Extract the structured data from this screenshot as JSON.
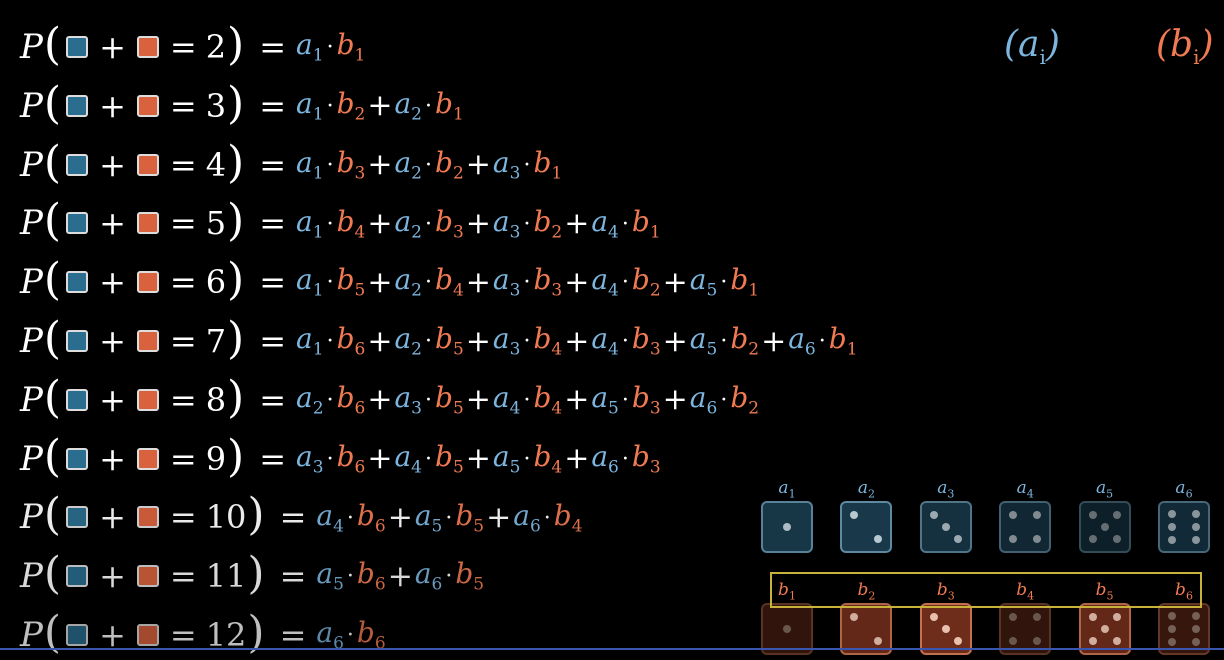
{
  "header": {
    "a_label": {
      "sym": "a",
      "sub": "i"
    },
    "b_label": {
      "sym": "b",
      "sub": "i"
    },
    "colors": {
      "a": "#7cb5de",
      "b": "#f07a52",
      "blue_die": "#2a6d8e",
      "red_die": "#d9623e",
      "highlight": "#c9b23a"
    }
  },
  "equations": [
    {
      "sum": "2",
      "terms": [
        [
          1,
          1
        ]
      ]
    },
    {
      "sum": "3",
      "terms": [
        [
          1,
          2
        ],
        [
          2,
          1
        ]
      ]
    },
    {
      "sum": "4",
      "terms": [
        [
          1,
          3
        ],
        [
          2,
          2
        ],
        [
          3,
          1
        ]
      ]
    },
    {
      "sum": "5",
      "terms": [
        [
          1,
          4
        ],
        [
          2,
          3
        ],
        [
          3,
          2
        ],
        [
          4,
          1
        ]
      ]
    },
    {
      "sum": "6",
      "terms": [
        [
          1,
          5
        ],
        [
          2,
          4
        ],
        [
          3,
          3
        ],
        [
          4,
          2
        ],
        [
          5,
          1
        ]
      ]
    },
    {
      "sum": "7",
      "terms": [
        [
          1,
          6
        ],
        [
          2,
          5
        ],
        [
          3,
          4
        ],
        [
          4,
          3
        ],
        [
          5,
          2
        ],
        [
          6,
          1
        ]
      ]
    },
    {
      "sum": "8",
      "terms": [
        [
          2,
          6
        ],
        [
          3,
          5
        ],
        [
          4,
          4
        ],
        [
          5,
          3
        ],
        [
          6,
          2
        ]
      ]
    },
    {
      "sum": "9",
      "terms": [
        [
          3,
          6
        ],
        [
          4,
          5
        ],
        [
          5,
          4
        ],
        [
          6,
          3
        ]
      ]
    },
    {
      "sum": "10",
      "terms": [
        [
          4,
          6
        ],
        [
          5,
          5
        ],
        [
          6,
          4
        ]
      ]
    },
    {
      "sum": "11",
      "terms": [
        [
          5,
          6
        ],
        [
          6,
          5
        ]
      ]
    },
    {
      "sum": "12",
      "terms": [
        [
          6,
          6
        ]
      ]
    }
  ],
  "row_opacity": [
    1,
    1,
    1,
    1,
    1,
    1,
    1,
    1,
    0.92,
    0.85,
    0.75
  ],
  "dice": {
    "blue": [
      {
        "sym": "a",
        "sub": "1",
        "face": 1
      },
      {
        "sym": "a",
        "sub": "2",
        "face": 2
      },
      {
        "sym": "a",
        "sub": "3",
        "face": 3
      },
      {
        "sym": "a",
        "sub": "4",
        "face": 4
      },
      {
        "sym": "a",
        "sub": "5",
        "face": 5
      },
      {
        "sym": "a",
        "sub": "6",
        "face": 6
      }
    ],
    "red": [
      {
        "sym": "b",
        "sub": "1",
        "face": 1
      },
      {
        "sym": "b",
        "sub": "2",
        "face": 2
      },
      {
        "sym": "b",
        "sub": "3",
        "face": 3
      },
      {
        "sym": "b",
        "sub": "4",
        "face": 4
      },
      {
        "sym": "b",
        "sub": "5",
        "face": 5
      },
      {
        "sym": "b",
        "sub": "6",
        "face": 6
      }
    ],
    "blue_opacity": [
      0.95,
      1,
      0.85,
      0.7,
      0.55,
      0.75
    ],
    "red_opacity": [
      0.45,
      0.9,
      1,
      0.45,
      0.9,
      0.5
    ]
  }
}
